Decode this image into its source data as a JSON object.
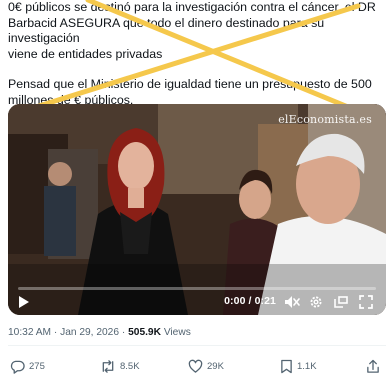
{
  "tweet": {
    "lines": [
      "0€ públicos se destinó para la investigación contra el cáncer, el DR",
      "Barbacid ASEGURA que todo el dinero destinado para su investigación",
      "viene de entidades privadas"
    ],
    "para2": [
      "Pensad que el Ministerio de igualdad tiene un presupuesto de 500",
      "millones de € públicos."
    ]
  },
  "video": {
    "watermark": "elEconomista.es",
    "time": "0:00 / 0:21",
    "progress": 0
  },
  "meta": {
    "timestamp": "10:32 AM · Jan 29, 2026",
    "separator": "·",
    "views_count": "505.9K",
    "views_label": "Views"
  },
  "actions": {
    "replies": "275",
    "reposts": "8.5K",
    "likes": "29K",
    "bookmarks": "1.1K"
  },
  "colors": {
    "cross": "#f5c84c",
    "accent": "#1d9bf0",
    "text": "#0f1419",
    "muted": "#536471"
  },
  "icons": [
    "play-icon",
    "volume-icon",
    "settings-icon",
    "pip-icon",
    "fullscreen-icon",
    "reply-icon",
    "repost-icon",
    "like-icon",
    "bookmark-icon",
    "share-icon"
  ]
}
